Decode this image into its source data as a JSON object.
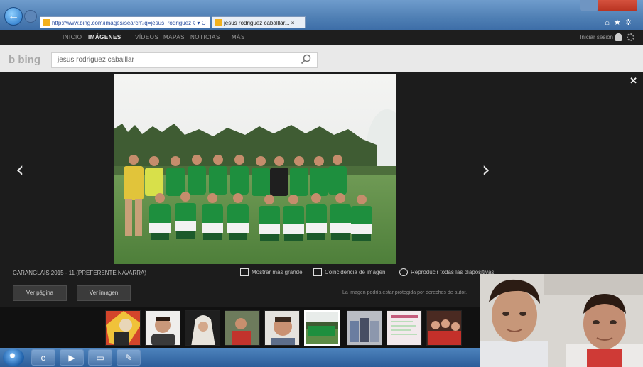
{
  "browser": {
    "address_url": "http://www.bing.com/images/search?q=jesus+rodriguez ◊ ▾ C",
    "tab_title": "jesus rodriguez caballlar... ×"
  },
  "bing_nav": {
    "items": [
      "INICIO",
      "IMÁGENES",
      "VÍDEOS",
      "MAPAS",
      "NOTICIAS",
      "MÁS"
    ],
    "signin": "Iniciar sesión"
  },
  "search": {
    "logo": "b bing",
    "query": "jesus rodriguez caballlar"
  },
  "viewer": {
    "caption": "CARANGLAIS 2015 - 11 (PREFERENTE NAVARRA)",
    "actions": [
      "Mostrar más grande",
      "Coincidencia de imagen",
      "Reproducir todas las diapositivas"
    ],
    "view_page": "Ver página",
    "view_image": "Ver imagen",
    "protect_note": "La imagen podría estar protegida por derechos de autor.",
    "prev": "‹",
    "next": "›",
    "close": "✕"
  },
  "colors": {
    "viewer_bg": "#1c1c1c",
    "jersey_green": "#1e8f3e",
    "taskbar": "#2c5e9a"
  }
}
